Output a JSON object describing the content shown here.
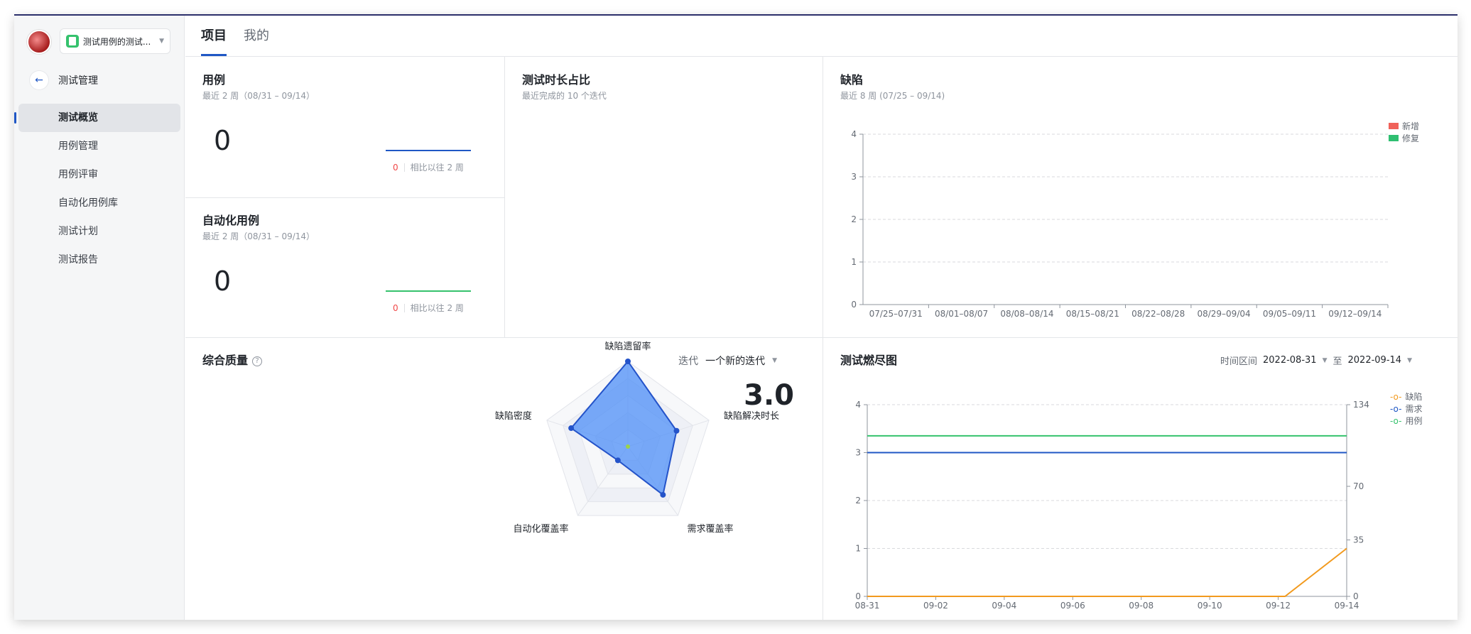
{
  "sidebar": {
    "project_name": "测试用例的测试...",
    "back_label": "测试管理",
    "items": [
      {
        "label": "测试概览",
        "active": true
      },
      {
        "label": "用例管理"
      },
      {
        "label": "用例评审"
      },
      {
        "label": "自动化用例库"
      },
      {
        "label": "测试计划"
      },
      {
        "label": "测试报告"
      }
    ]
  },
  "tabs": [
    {
      "label": "项目",
      "active": true
    },
    {
      "label": "我的"
    }
  ],
  "cases_card": {
    "title": "用例",
    "subtitle": "最近 2 周（08/31 – 09/14）",
    "value": "0",
    "delta": "0",
    "compare_label": "相比以往 2 周",
    "line_color": "#1f57c5"
  },
  "auto_card": {
    "title": "自动化用例",
    "subtitle": "最近 2 周（08/31 – 09/14）",
    "value": "0",
    "delta": "0",
    "compare_label": "相比以往 2 周",
    "line_color": "#35c26d"
  },
  "duration_card": {
    "title": "测试时长占比",
    "subtitle": "最近完成的 10 个迭代"
  },
  "quality_card": {
    "title": "综合质量",
    "help_icon": "question-circle-icon",
    "iteration_label": "迭代",
    "iteration_value": "一个新的迭代",
    "score": "3.0"
  },
  "burndown_card": {
    "title": "测试燃尽图",
    "range_label": "时间区间",
    "range_start": "2022-08-31",
    "range_to": "至",
    "range_end": "2022-09-14"
  },
  "chart_data": [
    {
      "type": "bar",
      "title": "缺陷",
      "subtitle": "最近 8 周 (07/25 – 09/14)",
      "categories": [
        "07/25–07/31",
        "08/01–08/07",
        "08/08–08/14",
        "08/15–08/21",
        "08/22–08/28",
        "08/29–09/04",
        "09/05–09/11",
        "09/12–09/14"
      ],
      "series": [
        {
          "name": "新增",
          "color": "#f0625a",
          "values": [
            0,
            0,
            0,
            0,
            0,
            0,
            0,
            0
          ]
        },
        {
          "name": "修复",
          "color": "#2fbf71",
          "values": [
            0,
            0,
            0,
            0,
            0,
            0,
            0,
            0
          ]
        }
      ],
      "ylim": [
        0,
        4
      ],
      "yticks": [
        "0",
        "1",
        "2",
        "3",
        "4"
      ],
      "grid": true,
      "legend": "top-right"
    },
    {
      "type": "radar",
      "axes": [
        "缺陷遗留率",
        "缺陷解决时长",
        "需求覆盖率",
        "自动化覆盖率",
        "缺陷密度"
      ],
      "values": [
        5,
        3,
        3.5,
        1,
        3.5
      ],
      "max": 5,
      "color": "#4d8ff7"
    },
    {
      "type": "line",
      "x": [
        "08-31",
        "09-02",
        "09-04",
        "09-06",
        "09-08",
        "09-10",
        "09-12",
        "09-14"
      ],
      "series": [
        {
          "name": "缺陷",
          "color": "#f29a1e",
          "points": [
            [
              0,
              0
            ],
            [
              12.2,
              0
            ],
            [
              14,
              1
            ]
          ]
        },
        {
          "name": "需求",
          "color": "#1f57c5",
          "points": [
            [
              0,
              3
            ],
            [
              14,
              3
            ]
          ]
        },
        {
          "name": "用例",
          "color": "#35c26d",
          "points": [
            [
              0,
              3.35
            ],
            [
              14,
              3.35
            ]
          ]
        }
      ],
      "ylim": [
        0,
        4
      ],
      "yticks": [
        "0",
        "1",
        "2",
        "3",
        "4"
      ],
      "y2ticks": [
        "0",
        "35",
        "70",
        "134"
      ],
      "grid": true,
      "legend": "top-right"
    }
  ]
}
